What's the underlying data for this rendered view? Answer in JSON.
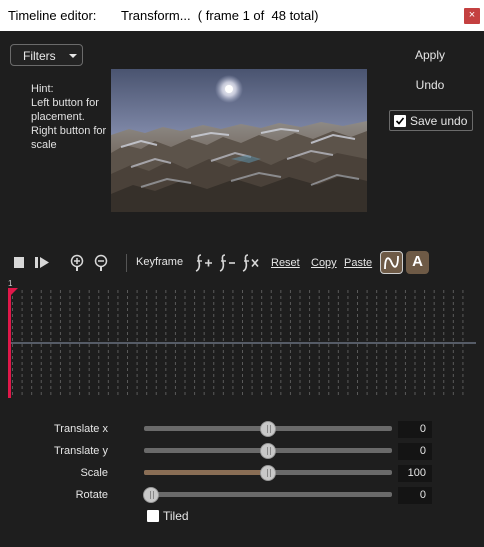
{
  "window": {
    "title_prefix": "Timeline editor:",
    "title_main": "Transform...  ( frame 1 of  48 total)",
    "close_glyph": "×"
  },
  "filters": {
    "label": "Filters"
  },
  "hint": {
    "text": "Hint:\nLeft button for placement.\nRight button for scale"
  },
  "actions": {
    "apply": "Apply",
    "undo": "Undo",
    "save_undo": "Save undo",
    "save_undo_checked": true
  },
  "toolbar": {
    "keyframe_label": "Keyframe",
    "reset": "Reset",
    "copy": "Copy",
    "paste": "Paste",
    "auto_label": "A",
    "icons": [
      "stop-icon",
      "play-icon",
      "zoom-in-icon",
      "zoom-out-icon",
      "add-keyframe-icon",
      "remove-keyframe-icon",
      "delete-keyframe-icon",
      "curve-icon",
      "auto-icon"
    ]
  },
  "timeline": {
    "frame_marker_label": "1",
    "current_frame": 1,
    "total_frames": 48
  },
  "params": [
    {
      "label": "Translate x",
      "value": "0",
      "position": 0.5
    },
    {
      "label": "Translate y",
      "value": "0",
      "position": 0.5
    },
    {
      "label": "Scale",
      "value": "100",
      "position": 0.5
    },
    {
      "label": "Rotate",
      "value": "0",
      "position": 0.03
    }
  ],
  "tiled": {
    "label": "Tiled",
    "checked": false
  },
  "colors": {
    "accent": "#8a6e55",
    "marker": "#e0184a",
    "background": "#1e1e1e",
    "close": "#c44040"
  }
}
